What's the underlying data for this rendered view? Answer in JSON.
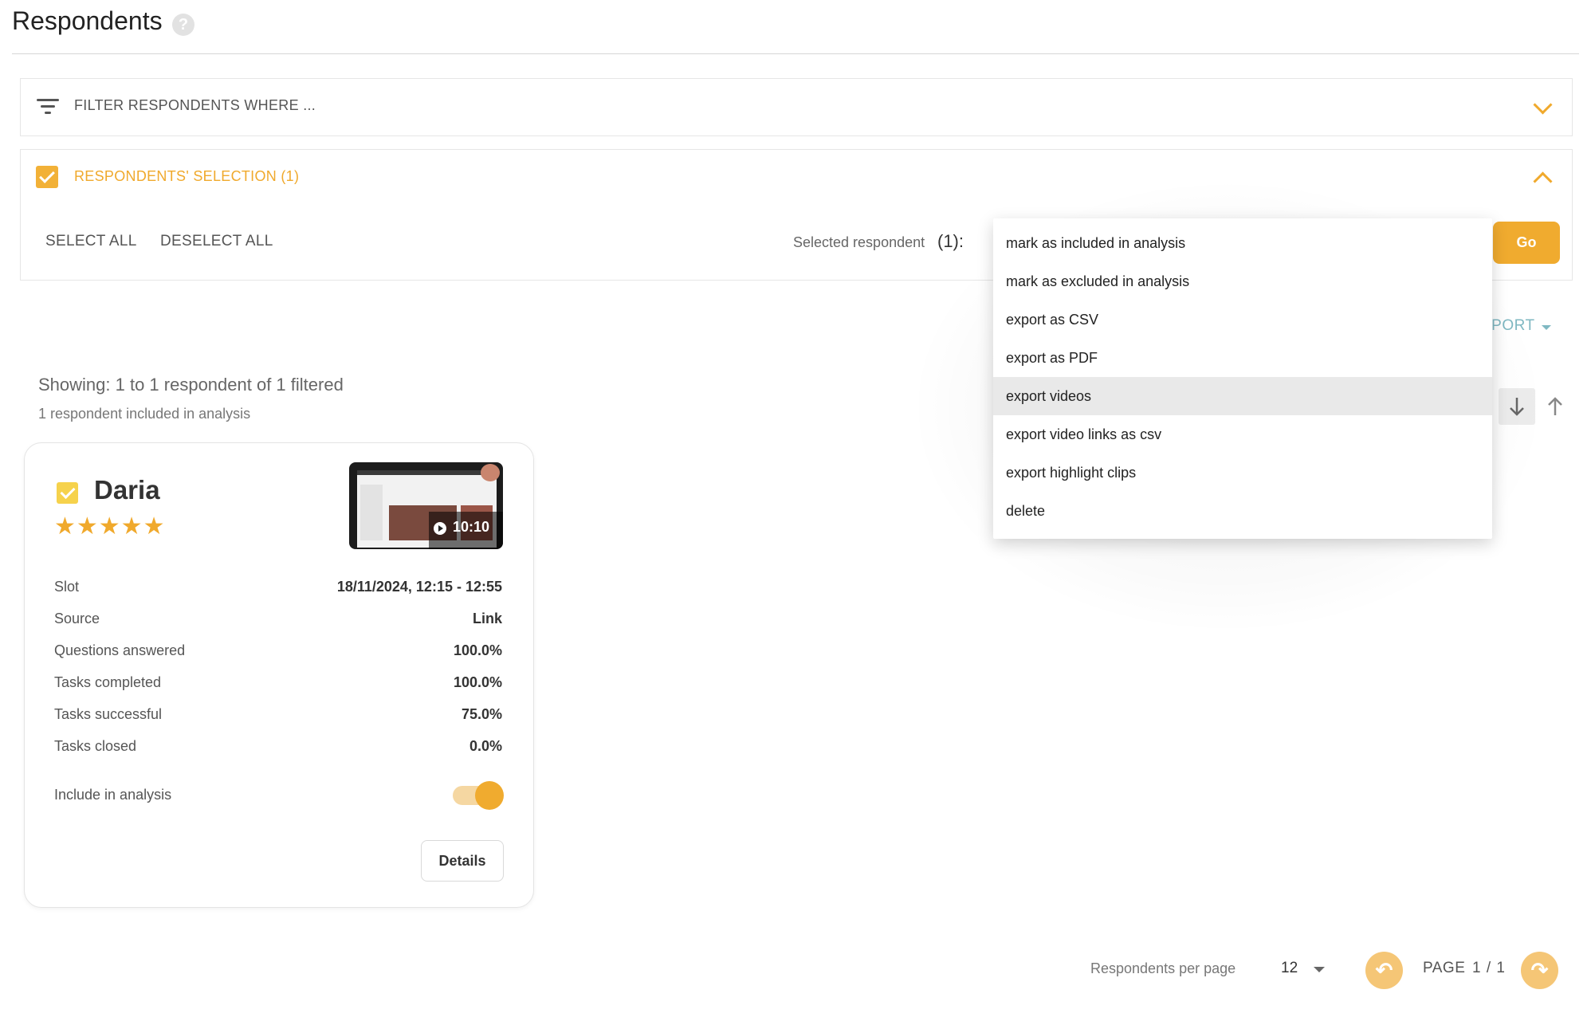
{
  "header": {
    "title": "Respondents",
    "help_glyph": "?"
  },
  "filter": {
    "label": "FILTER RESPONDENTS WHERE ..."
  },
  "selection": {
    "label": "RESPONDENTS' SELECTION (1)",
    "select_all": "SELECT ALL",
    "deselect_all": "DESELECT ALL",
    "selected_text": "Selected respondent",
    "selected_count": "(1):",
    "go_label": "Go"
  },
  "actions_menu": {
    "items": [
      "mark as included in analysis",
      "mark as excluded in analysis",
      "export as CSV",
      "export as PDF",
      "export videos",
      "export video links as csv",
      "export highlight clips",
      "delete"
    ],
    "highlighted_item": "export videos"
  },
  "export": {
    "label": "XPORT"
  },
  "summary": {
    "showing": "Showing: 1 to 1 respondent of 1 filtered",
    "included": "1 respondent included in analysis"
  },
  "card": {
    "name": "Daria",
    "rating": 5,
    "stars": "★★★★★",
    "video_duration": "10:10",
    "rows": [
      {
        "label": "Slot",
        "value": "18/11/2024, 12:15 - 12:55"
      },
      {
        "label": "Source",
        "value": "Link"
      },
      {
        "label": "Questions answered",
        "value": "100.0%"
      },
      {
        "label": "Tasks completed",
        "value": "100.0%"
      },
      {
        "label": "Tasks successful",
        "value": "75.0%"
      },
      {
        "label": "Tasks closed",
        "value": "0.0%"
      }
    ],
    "include_label": "Include in analysis",
    "include_on": true,
    "details_label": "Details"
  },
  "pagination": {
    "per_page_label": "Respondents per page",
    "per_page_value": "12",
    "page_label": "PAGE",
    "page_value": "1 / 1",
    "prev_glyph": "↶",
    "next_glyph": "↷"
  },
  "colors": {
    "accent": "#f0ab2f",
    "accent_light": "#f5c676",
    "teal": "#7fb8c2"
  },
  "icons": [
    "help-icon",
    "filter-icon",
    "chevron-down-icon",
    "chevron-up-icon",
    "checkbox-icon",
    "star-icon",
    "play-icon",
    "arrow-down-icon",
    "arrow-up-icon",
    "undo-icon",
    "redo-icon",
    "caret-down-icon"
  ]
}
